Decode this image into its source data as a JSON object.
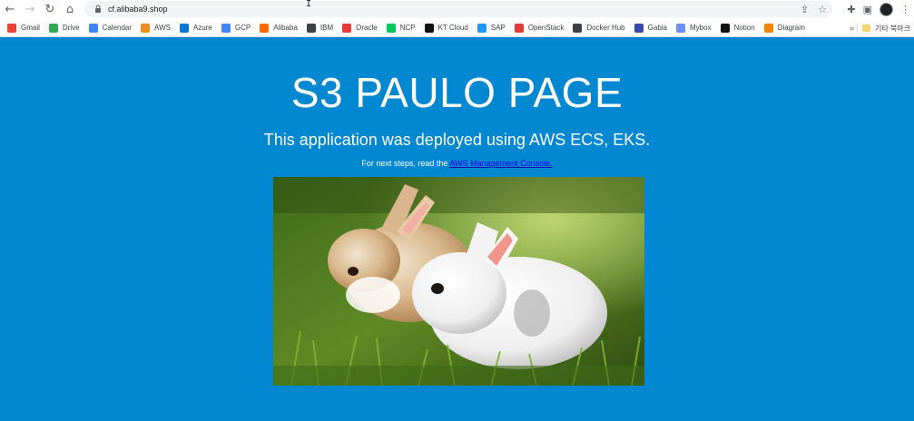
{
  "browser": {
    "url": "cf.alibaba9.shop",
    "icons": {
      "back": "arrow-left-icon",
      "forward": "arrow-right-icon",
      "reload": "reload-icon",
      "home": "home-icon",
      "lock": "lock-icon",
      "share": "share-icon",
      "bookmark": "star-icon",
      "extensions": "puzzle-icon",
      "side_panel": "side-panel-icon",
      "menu": "kebab-menu-icon"
    }
  },
  "bookmarks": [
    {
      "label": "Gmail",
      "color": "#ea4335"
    },
    {
      "label": "Drive",
      "color": "#34a853"
    },
    {
      "label": "Calendar",
      "color": "#4285f4"
    },
    {
      "label": "AWS",
      "color": "#f28b1c"
    },
    {
      "label": "Azure",
      "color": "#0078d4"
    },
    {
      "label": "GCP",
      "color": "#4285f4"
    },
    {
      "label": "Alibaba",
      "color": "#ff6a00"
    },
    {
      "label": "IBM",
      "color": "#3c4043"
    },
    {
      "label": "Oracle",
      "color": "#e53935"
    },
    {
      "label": "NCP",
      "color": "#03c75a"
    },
    {
      "label": "KT Cloud",
      "color": "#111111"
    },
    {
      "label": "SAP",
      "color": "#2196f3"
    },
    {
      "label": "OpenStack",
      "color": "#e53935"
    },
    {
      "label": "Docker Hub",
      "color": "#3c4043"
    },
    {
      "label": "Gabia",
      "color": "#3949ab"
    },
    {
      "label": "Mybox",
      "color": "#6c8ef5"
    },
    {
      "label": "Notion",
      "color": "#111111"
    },
    {
      "label": "Diagram",
      "color": "#f08705"
    }
  ],
  "bookmarks_more": "»",
  "bookmarks_other": "기타 북마크",
  "page": {
    "title": "S3 PAULO PAGE",
    "subtitle": "This application was deployed using AWS ECS, EKS.",
    "note_prefix": "For next steps, read the ",
    "note_link": "AWS Management Console.",
    "image_alt": "two-bunnies-photo"
  },
  "colors": {
    "page_background": "#0288d1",
    "text": "#ffffff",
    "link": "#0000ee"
  }
}
